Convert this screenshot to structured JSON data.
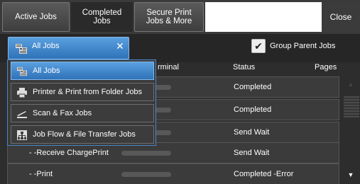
{
  "tabs": [
    {
      "label": "Active Jobs"
    },
    {
      "label": "Completed Jobs"
    },
    {
      "label": "Secure Print Jobs & More"
    }
  ],
  "close_label": "Close",
  "filter": {
    "selected": "All Jobs",
    "clear_icon": "x-icon",
    "group_parent_label": "Group Parent Jobs",
    "group_parent_checked": true
  },
  "table": {
    "headers": {
      "terminal": "rminal",
      "status": "Status",
      "pages": "Pages"
    },
    "rows": [
      {
        "name": "",
        "status": "Completed"
      },
      {
        "name": "",
        "status": "Completed"
      },
      {
        "name": "",
        "status": "Send Wait"
      },
      {
        "name": "- -Receive ChargePrint",
        "status": "Send Wait"
      },
      {
        "name": "- -Print",
        "status": "Completed -Error"
      }
    ]
  },
  "dropdown": {
    "options": [
      {
        "label": "All Jobs",
        "icon": "all-jobs-icon"
      },
      {
        "label": "Printer & Print from Folder Jobs",
        "icon": "printer-icon"
      },
      {
        "label": "Scan & Fax Jobs",
        "icon": "scanner-icon"
      },
      {
        "label": "Job Flow & File Transfer Jobs",
        "icon": "job-flow-icon"
      }
    ]
  },
  "colors": {
    "accent": "#3a84d0",
    "background": "#2d2d2d"
  }
}
